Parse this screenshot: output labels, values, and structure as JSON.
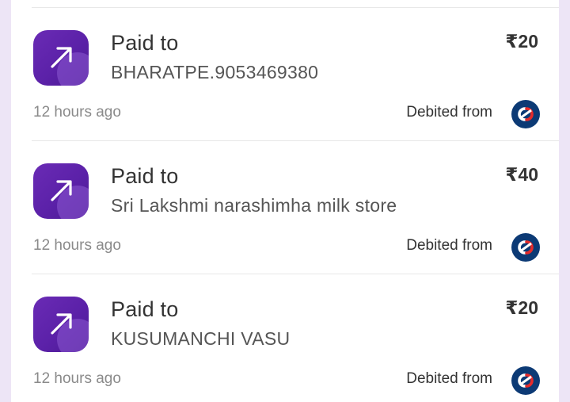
{
  "transactions": [
    {
      "label": "Paid to",
      "payee": "BHARATPE.9053469380",
      "amount": "₹20",
      "time": "12 hours ago",
      "debited_label": "Debited from",
      "icon": "arrow-up-right-icon",
      "bank_icon": "kotak-bank-logo"
    },
    {
      "label": "Paid to",
      "payee": "Sri Lakshmi narashimha milk store",
      "amount": "₹40",
      "time": "12 hours ago",
      "debited_label": "Debited from",
      "icon": "arrow-up-right-icon",
      "bank_icon": "kotak-bank-logo"
    },
    {
      "label": "Paid to",
      "payee": "KUSUMANCHI VASU",
      "amount": "₹20",
      "time": "12 hours ago",
      "debited_label": "Debited from",
      "icon": "arrow-up-right-icon",
      "bank_icon": "kotak-bank-logo"
    }
  ],
  "colors": {
    "background": "#ede5f6",
    "icon_purple": "#5b21a8",
    "bank_blue": "#0c3a75",
    "bank_red": "#e52b2b"
  }
}
